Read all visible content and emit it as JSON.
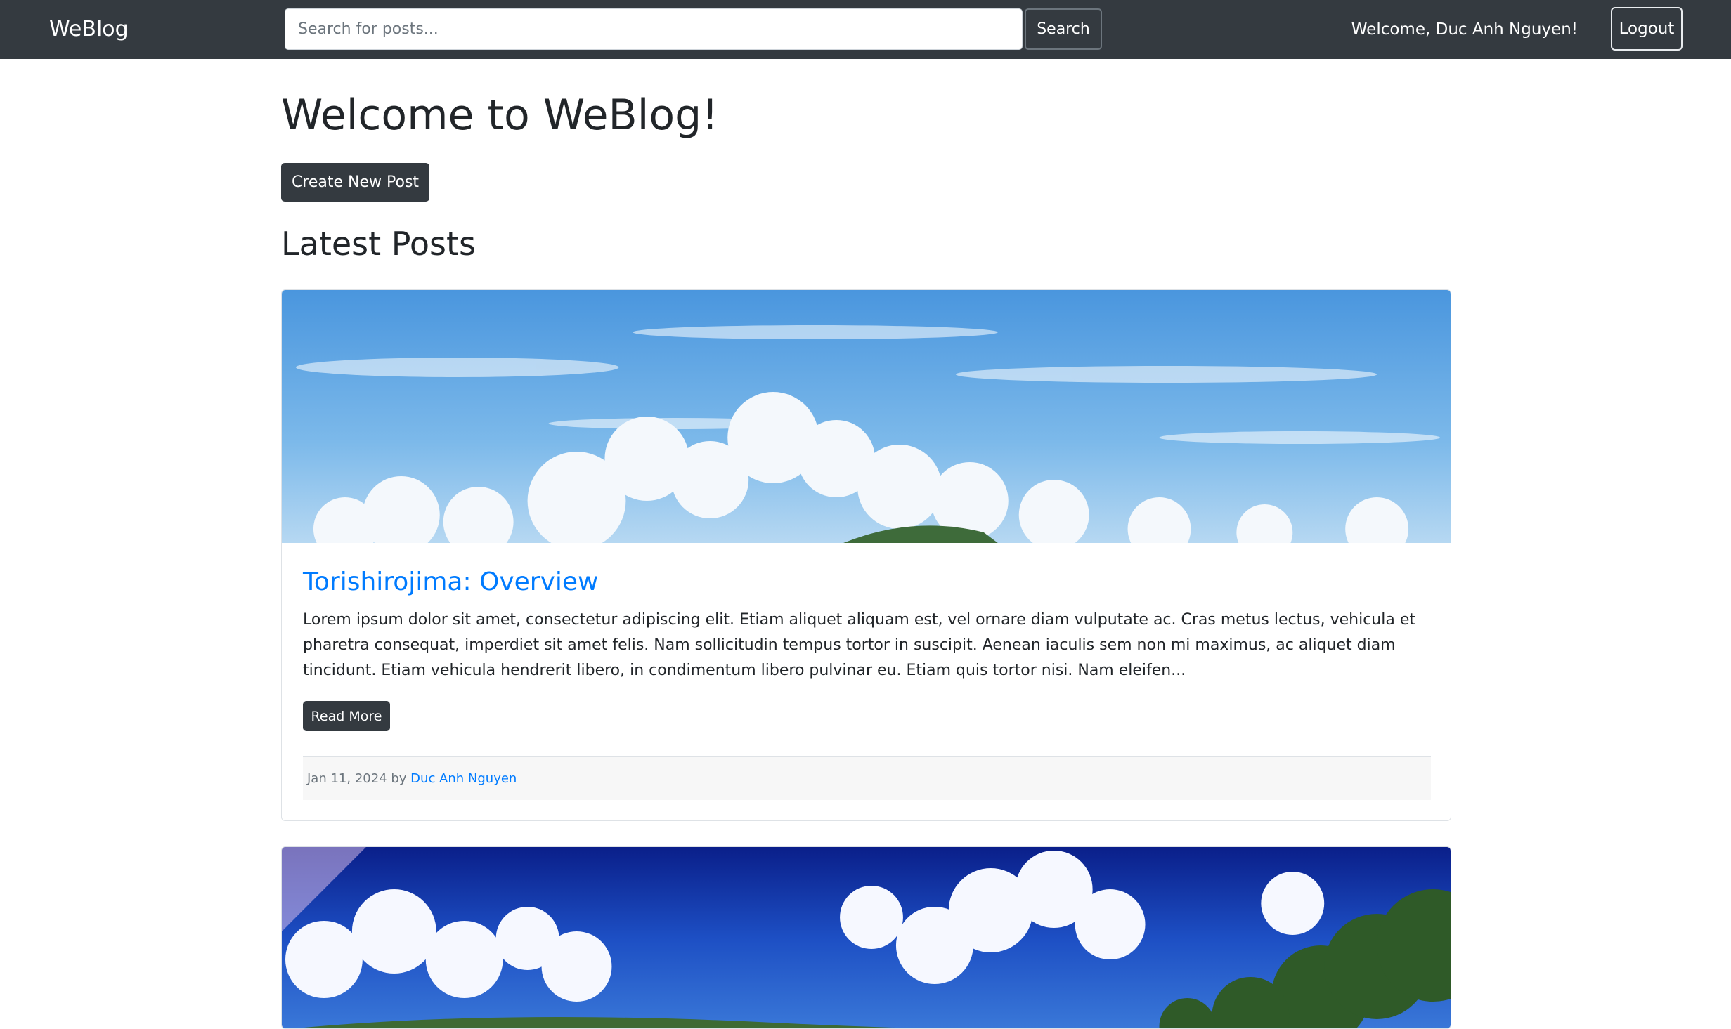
{
  "navbar": {
    "brand": "WeBlog",
    "search_placeholder": "Search for posts...",
    "search_button": "Search",
    "welcome": "Welcome, Duc Anh Nguyen!",
    "logout_button": "Logout"
  },
  "main": {
    "title": "Welcome to WeBlog!",
    "create_button": "Create New Post",
    "section_title": "Latest Posts"
  },
  "posts": [
    {
      "title": "Torishirojima: Overview",
      "excerpt": "Lorem ipsum dolor sit amet, consectetur adipiscing elit. Etiam aliquet aliquam est, vel ornare diam vulputate ac. Cras metus lectus, vehicula et pharetra consequat, imperdiet sit amet felis. Nam sollicitudin tempus tortor in suscipit. Aenean iaculis sem non mi maximus, ac aliquet diam tincidunt. Etiam vehicula hendrerit libero, in condimentum libero pulvinar eu. Etiam quis tortor nisi. Nam eleifen...",
      "read_more": "Read More",
      "date": "Jan 11, 2024",
      "by": "by",
      "author": "Duc Anh Nguyen"
    }
  ],
  "colors": {
    "navbar_bg": "#343a40",
    "link": "#007bff",
    "button_dark": "#343a40"
  }
}
